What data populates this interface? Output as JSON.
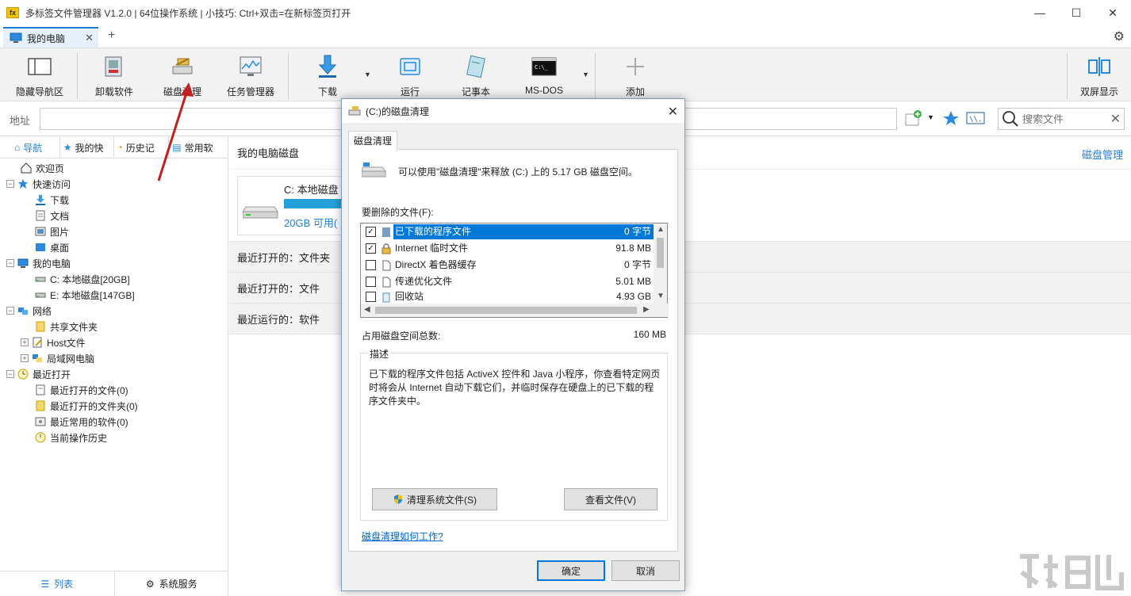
{
  "window": {
    "app_icon_text": "fx",
    "title": "多标签文件管理器 V1.2.0  |  64位操作系统  |  小技巧: Ctrl+双击=在新标签页打开",
    "controls": {
      "minimize": "—",
      "maximize": "☐",
      "close": "✕"
    }
  },
  "tabs": [
    {
      "label": "我的电脑",
      "close": "✕"
    }
  ],
  "tab_add": "+",
  "toolbar": {
    "items": [
      {
        "id": "hide-nav",
        "label": "隐藏导航区",
        "icon": "panel-icon"
      },
      {
        "id": "uninstall",
        "label": "卸载软件",
        "icon": "uninstall-icon"
      },
      {
        "id": "disk-cleanup",
        "label": "磁盘清理",
        "icon": "disk-cleanup-icon"
      },
      {
        "id": "task-manager",
        "label": "任务管理器",
        "icon": "task-manager-icon"
      },
      {
        "id": "download",
        "label": "下载",
        "icon": "download-icon"
      },
      {
        "id": "run",
        "label": "运行",
        "icon": "run-icon"
      },
      {
        "id": "notepad",
        "label": "记事本",
        "icon": "notepad-icon"
      },
      {
        "id": "msdos",
        "label": "MS-DOS",
        "icon": "cmd-icon"
      },
      {
        "id": "add",
        "label": "添加",
        "icon": "plus-icon"
      },
      {
        "id": "dual-screen",
        "label": "双屏显示",
        "icon": "dual-screen-icon"
      }
    ]
  },
  "address": {
    "label": "地址",
    "value": "",
    "search_placeholder": "搜索文件"
  },
  "left_panel": {
    "tabs": [
      {
        "label": "导航",
        "active": true
      },
      {
        "label": "我的快"
      },
      {
        "label": "历史记"
      },
      {
        "label": "常用软"
      }
    ],
    "tree": [
      {
        "label": "欢迎页",
        "level": 0,
        "expander": ""
      },
      {
        "label": "快速访问",
        "level": 0,
        "expander": "−"
      },
      {
        "label": "下载",
        "level": 1,
        "expander": ""
      },
      {
        "label": "文档",
        "level": 1,
        "expander": ""
      },
      {
        "label": "图片",
        "level": 1,
        "expander": ""
      },
      {
        "label": "桌面",
        "level": 1,
        "expander": ""
      },
      {
        "label": "我的电脑",
        "level": 0,
        "expander": "−"
      },
      {
        "label": "C: 本地磁盘[20GB]",
        "level": 1,
        "expander": ""
      },
      {
        "label": "E: 本地磁盘[147GB]",
        "level": 1,
        "expander": ""
      },
      {
        "label": "网络",
        "level": 0,
        "expander": "−"
      },
      {
        "label": "共享文件夹",
        "level": 1,
        "expander": ""
      },
      {
        "label": "Host文件",
        "level": 1,
        "expander": "+"
      },
      {
        "label": "局域网电脑",
        "level": 1,
        "expander": "+"
      },
      {
        "label": "最近打开",
        "level": 0,
        "expander": "−"
      },
      {
        "label": "最近打开的文件(0)",
        "level": 1,
        "expander": ""
      },
      {
        "label": "最近打开的文件夹(0)",
        "level": 1,
        "expander": ""
      },
      {
        "label": "最近常用的软件(0)",
        "level": 1,
        "expander": ""
      },
      {
        "label": "当前操作历史",
        "level": 1,
        "expander": ""
      }
    ],
    "bottom": {
      "list_label": "列表",
      "service_label": "系统服务"
    }
  },
  "main": {
    "header": "我的电脑磁盘",
    "disk_mgmt_link": "磁盘管理",
    "disk": {
      "name": "C: 本地磁盘",
      "free": "20GB 可用("
    },
    "sections": [
      "最近打开的：文件夹",
      "最近打开的：文件",
      "最近运行的：软件"
    ]
  },
  "dialog": {
    "title": "(C:)的磁盘清理",
    "tab": "磁盘清理",
    "intro": "可以使用\"磁盘清理\"来释放  (C:) 上的 5.17 GB 磁盘空间。",
    "files_label": "要删除的文件(F):",
    "files": [
      {
        "name": "已下载的程序文件",
        "size": "0 字节",
        "checked": "✓",
        "selected": true
      },
      {
        "name": "Internet 临时文件",
        "size": "91.8 MB",
        "checked": "✓"
      },
      {
        "name": "DirectX 着色器缓存",
        "size": "0 字节",
        "checked": ""
      },
      {
        "name": "传递优化文件",
        "size": "5.01 MB",
        "checked": ""
      },
      {
        "name": "回收站",
        "size": "4.93 GB",
        "checked": ""
      }
    ],
    "total_label": "占用磁盘空间总数:",
    "total_value": "160 MB",
    "desc_legend": "描述",
    "desc_text": "已下载的程序文件包括 ActiveX 控件和 Java 小程序，你查看特定网页时将会从 Internet 自动下载它们，并临时保存在硬盘上的已下载的程序文件夹中。",
    "clean_system_btn": "清理系统文件(S)",
    "view_files_btn": "查看文件(V)",
    "help_link": "磁盘清理如何工作?",
    "ok": "确定",
    "cancel": "取消",
    "close": "✕"
  },
  "colors": {
    "accent": "#1e7fd8",
    "selection": "#0078d7",
    "annotation": "#c42020"
  }
}
